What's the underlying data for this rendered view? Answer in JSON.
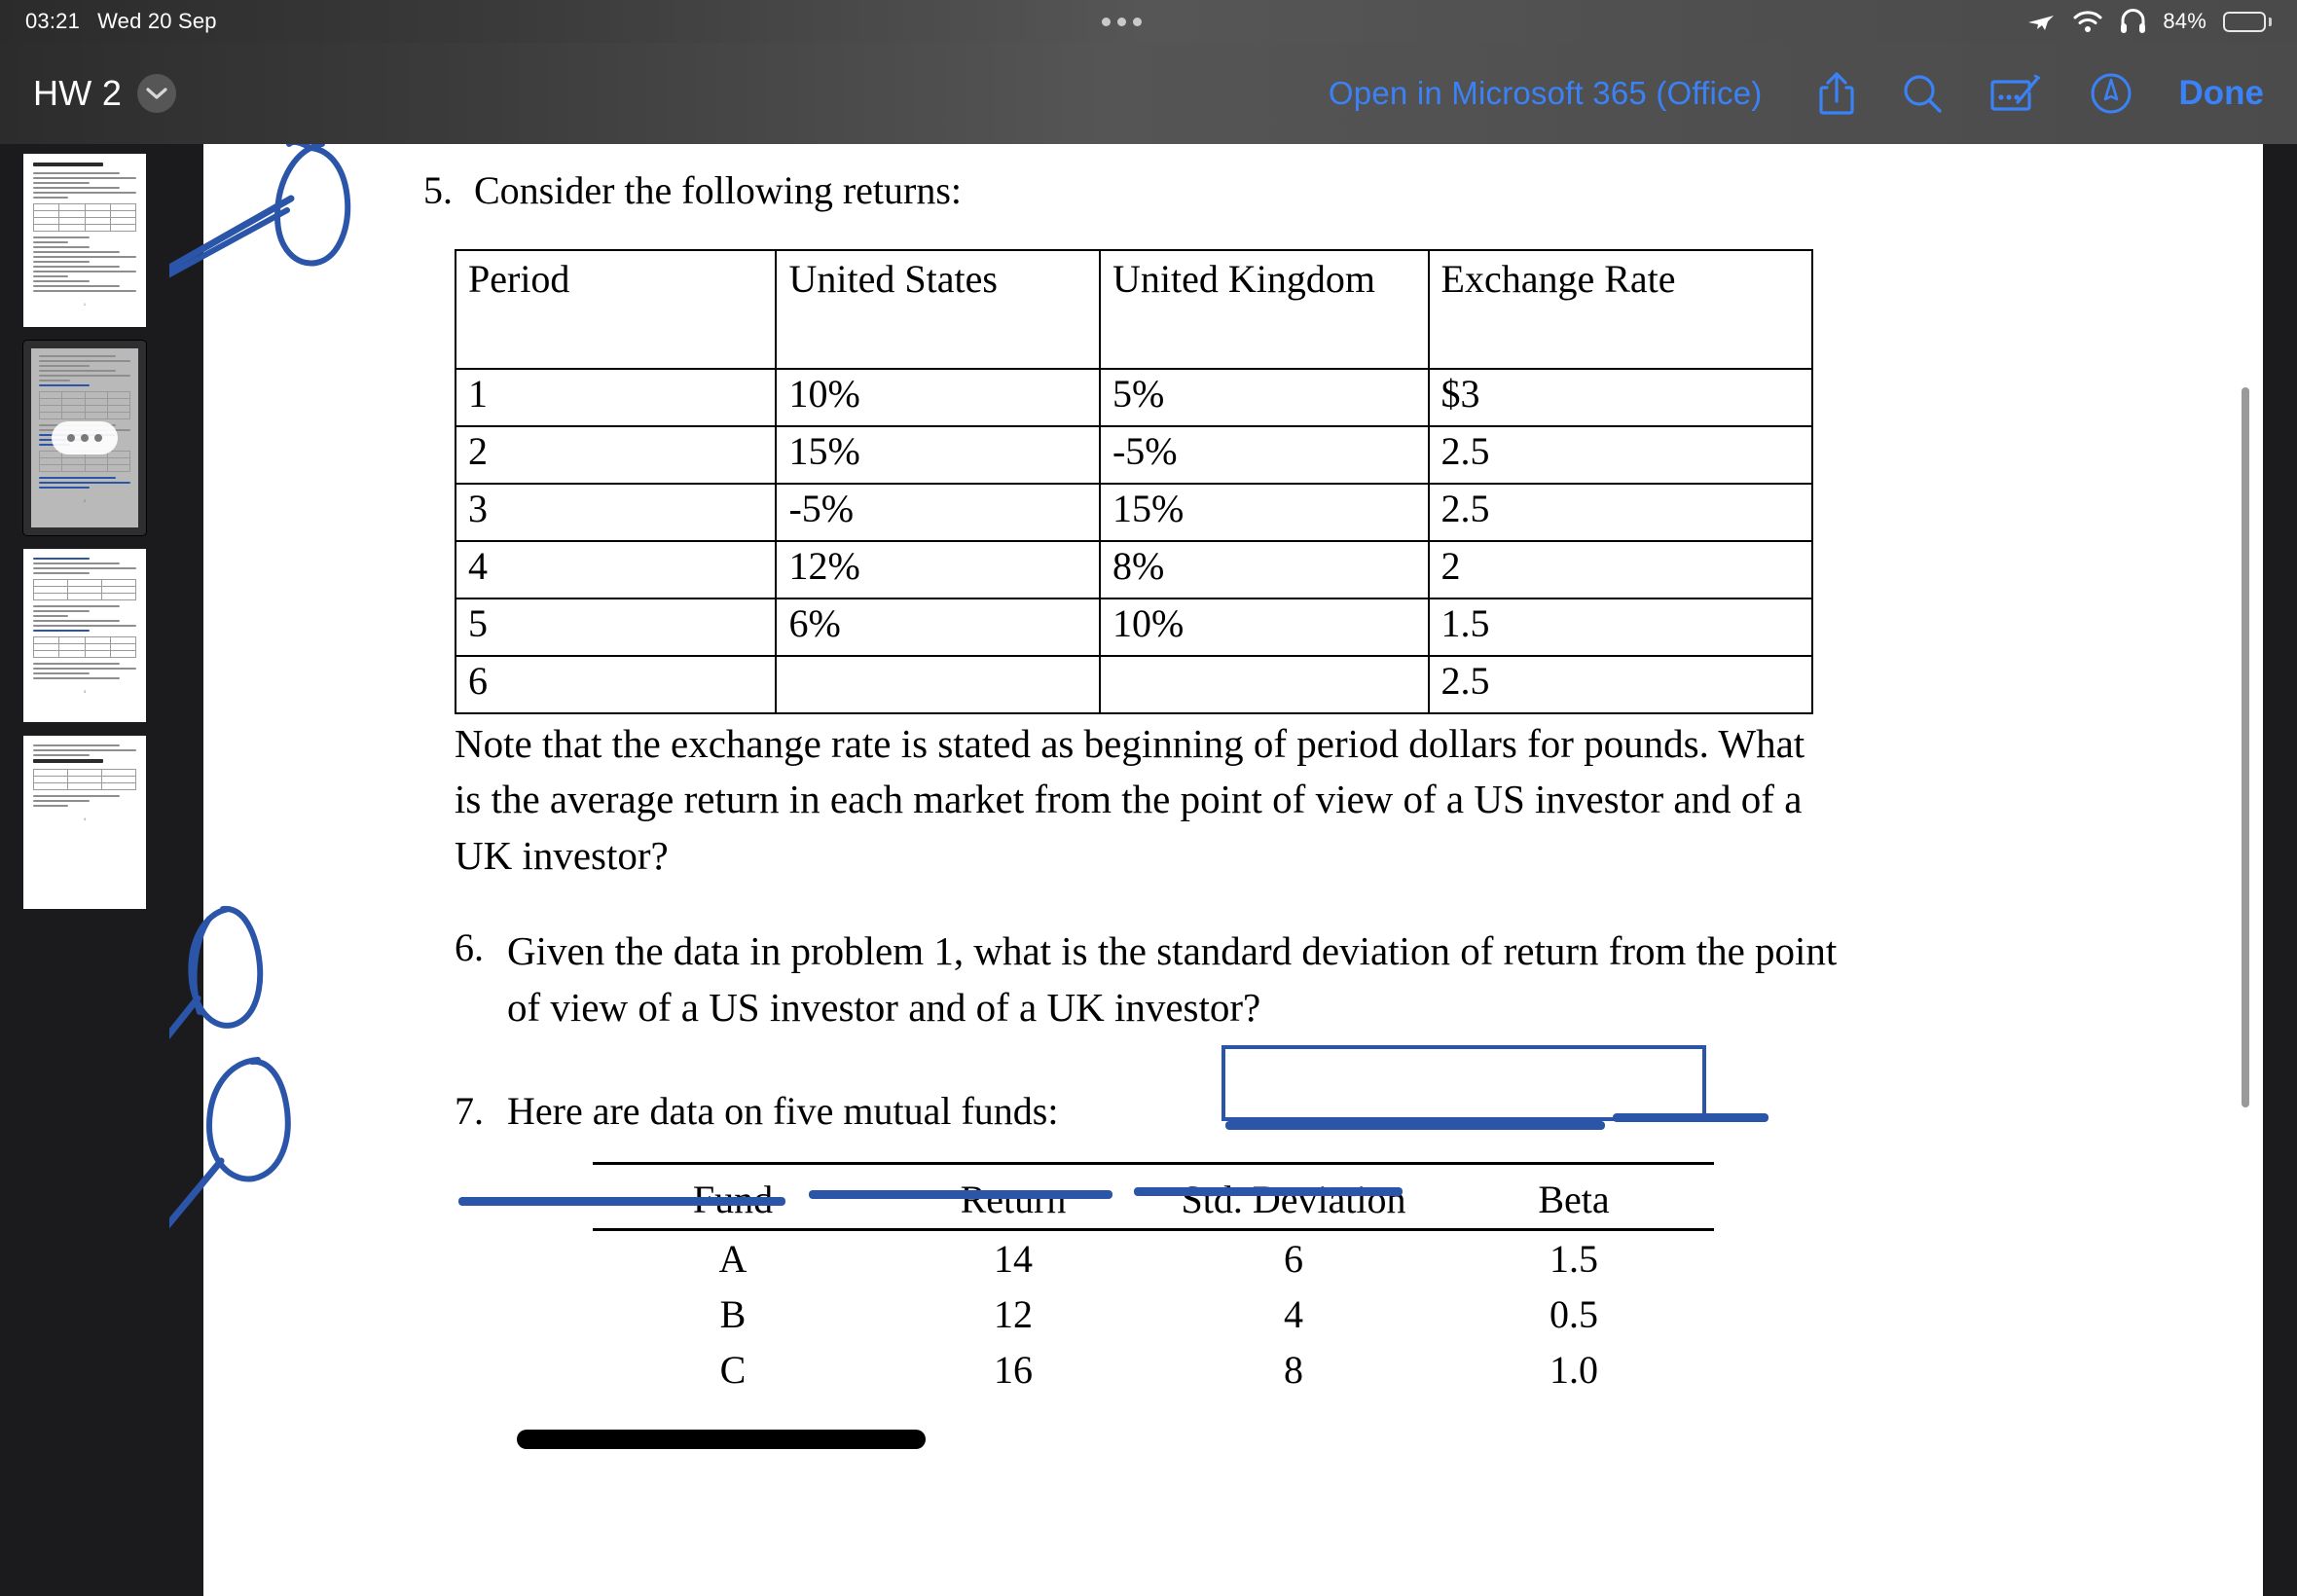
{
  "status_bar": {
    "time": "03:21",
    "date": "Wed 20 Sep",
    "battery_percent": "84%",
    "icons": [
      "airplane-mode-icon",
      "wifi-icon",
      "headphones-icon",
      "battery-icon"
    ]
  },
  "toolbar": {
    "title": "HW 2",
    "chevron_icon": "chevron-down-icon",
    "open_in_label": "Open in Microsoft  365  (Office)",
    "icons": [
      "share-icon",
      "search-icon",
      "markup-icon",
      "annotate-pencil-icon"
    ],
    "done_label": "Done"
  },
  "sidebar": {
    "pages": [
      {
        "number": "1",
        "selected": false
      },
      {
        "number": "2",
        "selected": true
      },
      {
        "number": "3",
        "selected": false
      },
      {
        "number": "4",
        "selected": false
      }
    ]
  },
  "document": {
    "question5": {
      "number": "5.",
      "text": "Consider the following returns:",
      "table": {
        "headers": [
          "Period",
          "United States",
          "United Kingdom",
          "Exchange Rate"
        ],
        "rows": [
          [
            "1",
            "10%",
            "5%",
            "$3"
          ],
          [
            "2",
            "15%",
            "-5%",
            "2.5"
          ],
          [
            "3",
            "-5%",
            "15%",
            "2.5"
          ],
          [
            "4",
            "12%",
            "8%",
            "2"
          ],
          [
            "5",
            "6%",
            "10%",
            "1.5"
          ],
          [
            "6",
            "",
            "",
            "2.5"
          ]
        ]
      },
      "note": "Note that the exchange rate is stated as beginning of period dollars for pounds. What is the average return in each market from the point of view of a US investor and of a UK investor?"
    },
    "question6": {
      "number": "6.",
      "text": "Given the data in problem 1, what is the standard deviation of return from the point of view of a US investor and of a UK investor?"
    },
    "question7": {
      "number": "7.",
      "text": "Here are data on five mutual funds:",
      "table": {
        "headers": [
          "Fund",
          "Return",
          "Std. Deviation",
          "Beta"
        ],
        "rows": [
          [
            "A",
            "14",
            "6",
            "1.5"
          ],
          [
            "B",
            "12",
            "4",
            "0.5"
          ],
          [
            "C",
            "16",
            "8",
            "1.0"
          ]
        ]
      }
    }
  },
  "annotations": {
    "ink_color": "#2b55a8",
    "marker_color": "#000000",
    "items": [
      "circle-around-5-with-arrow",
      "circle-around-6-with-arrow",
      "circle-around-7-with-arrow",
      "blue-box-standard-deviation-of-return",
      "blue-underline-standard-deviation-of-return",
      "blue-underline-from",
      "blue-underline-the-point-of-view",
      "blue-underline-of-a-US-investor",
      "blue-underline-a-UK-investor",
      "black-marker-stroke-row-C"
    ]
  }
}
